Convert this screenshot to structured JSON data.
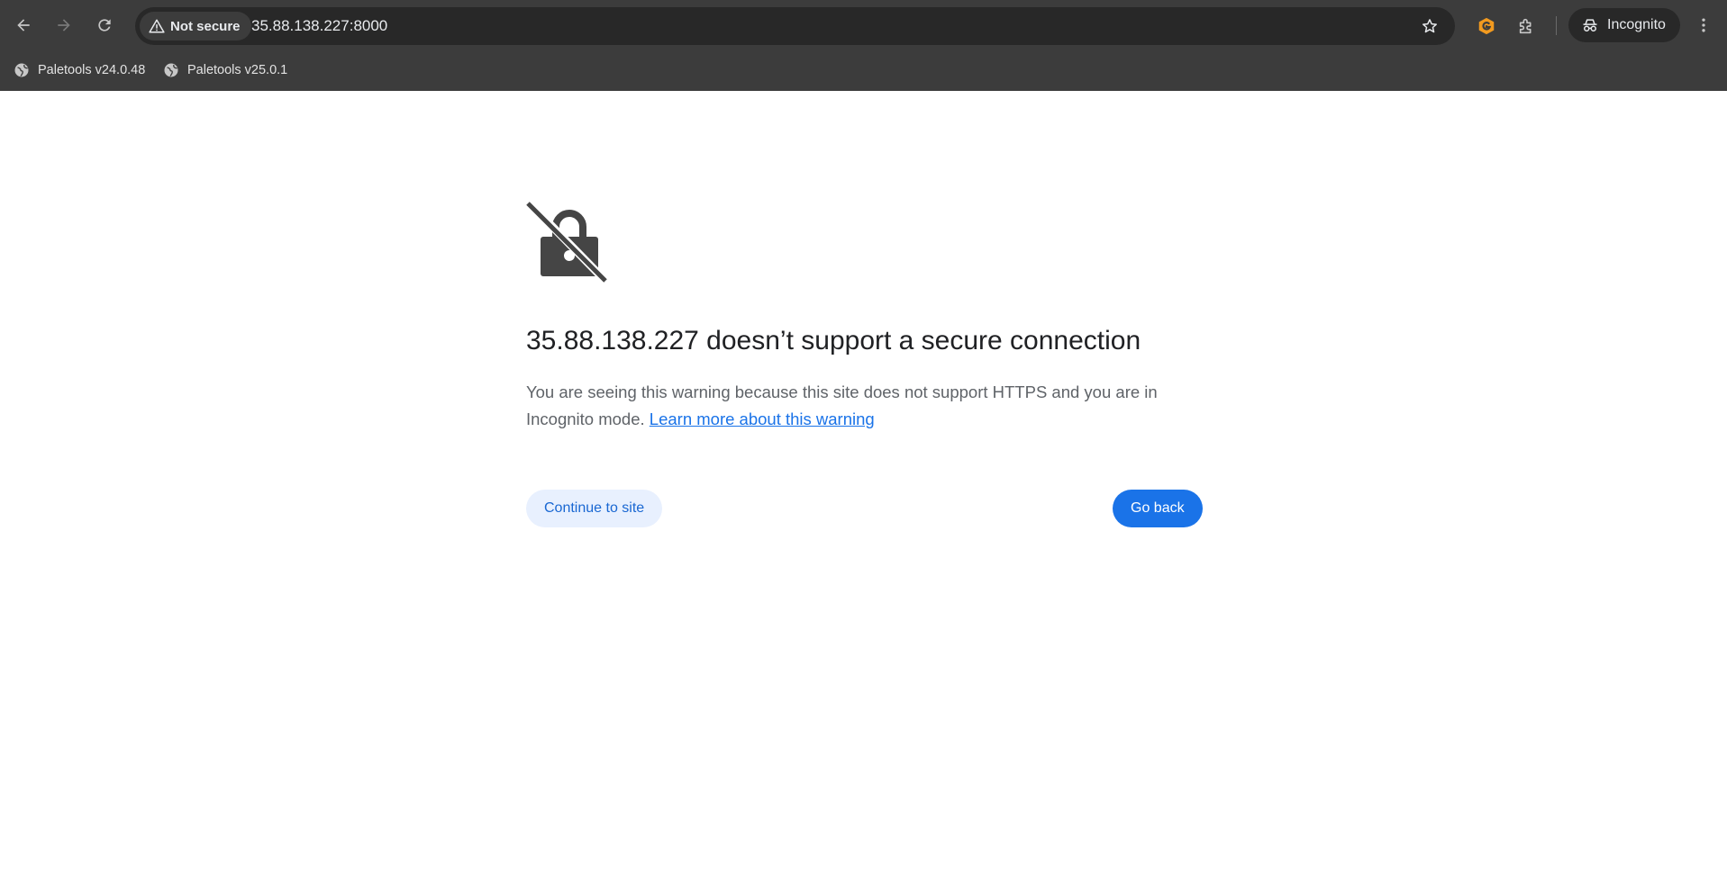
{
  "browser": {
    "security_label": "Not secure",
    "url": "35.88.138.227:8000",
    "profile_label": "Incognito",
    "bookmarks": [
      {
        "label": "Paletools v24.0.48",
        "icon": "globe-icon"
      },
      {
        "label": "Paletools v25.0.1",
        "icon": "globe-icon"
      }
    ],
    "icons": {
      "back": "arrow-left-icon",
      "forward": "arrow-right-icon",
      "reload": "reload-icon",
      "security": "warning-triangle-icon",
      "bookmark_star": "star-outline-icon",
      "extension_one": "orange-g-extension-icon",
      "extensions_menu": "puzzle-icon",
      "profile": "incognito-icon",
      "menu": "three-dots-vertical-icon"
    }
  },
  "page": {
    "icon": "broken-lock-icon",
    "heading": "35.88.138.227 doesn’t support a secure connection",
    "body_text": "You are seeing this warning because this site does not support HTTPS and you are in Incognito mode.",
    "learn_more_link": "Learn more about this warning",
    "continue_button": "Continue to site",
    "back_button": "Go back"
  },
  "colors": {
    "browser_frame": "#3c3c3c",
    "omnibox": "#282828",
    "page_background": "#ffffff",
    "primary_button": "#1a73e8",
    "secondary_button": "#e8f0fe",
    "link": "#1a73e8",
    "extension_orange": "#f29a1f"
  }
}
